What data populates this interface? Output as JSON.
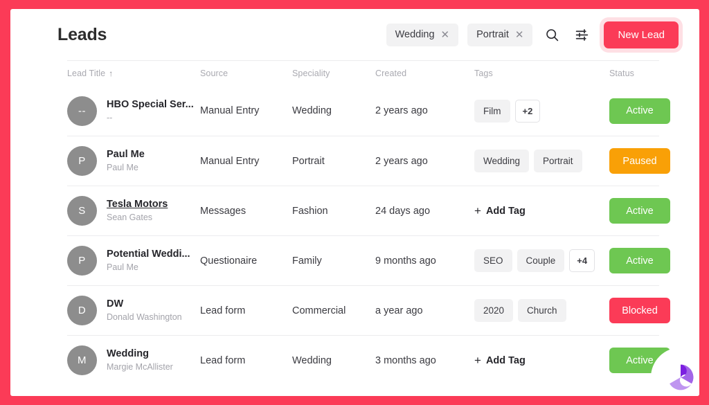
{
  "theme": {
    "frame_color": "#fb3b57",
    "accent": "#fb3b57",
    "status_active": "#6ec752",
    "status_paused": "#f9a007",
    "status_blocked": "#fb3b57",
    "avatar_bg": "#8d8d8d",
    "chip_bg": "#f2f2f3"
  },
  "header": {
    "title": "Leads",
    "filter_chips": [
      {
        "label": "Wedding",
        "remove_label": "✕"
      },
      {
        "label": "Portrait",
        "remove_label": "✕"
      }
    ],
    "search_icon": "search-icon",
    "filter_icon": "tune-icon",
    "new_lead_label": "New Lead"
  },
  "table": {
    "columns": [
      {
        "key": "title",
        "label": "Lead Title",
        "sorted": true,
        "sort_arrow": "↑"
      },
      {
        "key": "source",
        "label": "Source"
      },
      {
        "key": "spec",
        "label": "Speciality"
      },
      {
        "key": "created",
        "label": "Created"
      },
      {
        "key": "tags",
        "label": "Tags"
      },
      {
        "key": "status",
        "label": "Status"
      }
    ],
    "rows": [
      {
        "avatar": "--",
        "name": "HBO Special Ser...",
        "sub": "--",
        "linked": false,
        "source": "Manual Entry",
        "speciality": "Wedding",
        "created": "2 years ago",
        "tags": [
          "Film"
        ],
        "more_tags": "+2",
        "add_tag": null,
        "status": "Active",
        "status_color": "#6ec752"
      },
      {
        "avatar": "P",
        "name": "Paul Me",
        "sub": "Paul Me",
        "linked": false,
        "source": "Manual Entry",
        "speciality": "Portrait",
        "created": "2 years ago",
        "tags": [
          "Wedding",
          "Portrait"
        ],
        "more_tags": null,
        "add_tag": null,
        "status": "Paused",
        "status_color": "#f9a007"
      },
      {
        "avatar": "S",
        "name": "Tesla Motors",
        "sub": "Sean Gates",
        "linked": true,
        "source": "Messages",
        "speciality": "Fashion",
        "created": "24 days ago",
        "tags": [],
        "more_tags": null,
        "add_tag": "Add Tag",
        "status": "Active",
        "status_color": "#6ec752"
      },
      {
        "avatar": "P",
        "name": "Potential Weddi...",
        "sub": "Paul Me",
        "linked": false,
        "source": "Questionaire",
        "speciality": "Family",
        "created": "9 months ago",
        "tags": [
          "SEO",
          "Couple"
        ],
        "more_tags": "+4",
        "add_tag": null,
        "status": "Active",
        "status_color": "#6ec752"
      },
      {
        "avatar": "D",
        "name": "DW",
        "sub": "Donald Washington",
        "linked": false,
        "source": "Lead form",
        "speciality": "Commercial",
        "created": "a year ago",
        "tags": [
          "2020",
          "Church"
        ],
        "more_tags": null,
        "add_tag": null,
        "status": "Blocked",
        "status_color": "#fb3b57"
      },
      {
        "avatar": "M",
        "name": "Wedding",
        "sub": "Margie McAllister",
        "linked": false,
        "source": "Lead form",
        "speciality": "Wedding",
        "created": "3 months ago",
        "tags": [],
        "more_tags": null,
        "add_tag": "Add Tag",
        "status": "Active",
        "status_color": "#6ec752"
      }
    ]
  },
  "fab": {
    "icon": "pinwheel-logo-icon"
  }
}
